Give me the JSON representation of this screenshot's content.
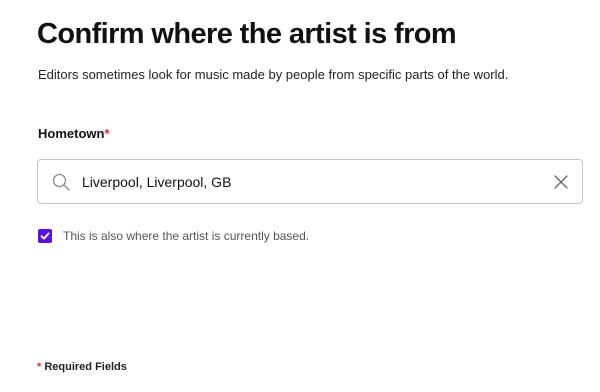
{
  "header": {
    "title": "Confirm where the artist is from",
    "subtitle": "Editors sometimes look for music made by people from specific parts of the world."
  },
  "hometown": {
    "label": "Hometown",
    "required_marker": "*",
    "value": "Liverpool, Liverpool, GB",
    "icons": {
      "search": "search-icon",
      "clear": "close-icon"
    }
  },
  "current_base": {
    "checked": true,
    "label": "This is also where the artist is currently based."
  },
  "footer": {
    "required_marker": "*",
    "required_note": "Required Fields"
  },
  "colors": {
    "accent": "#5b14e0",
    "required": "#e22134",
    "border": "#c4c4c4",
    "text": "#111111",
    "muted_text": "#555555"
  }
}
